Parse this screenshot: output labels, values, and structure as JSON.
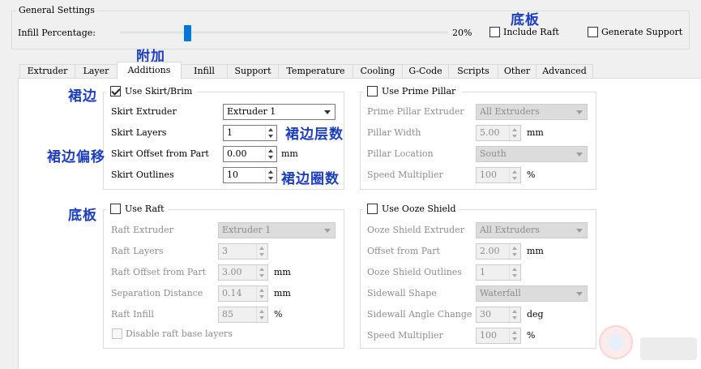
{
  "general": {
    "title": "General Settings",
    "infill_label": "Infill Percentage:",
    "infill_value": "20%",
    "infill_fraction": 0.2,
    "include_raft": "Include Raft",
    "generate_support": "Generate Support"
  },
  "tabs": [
    "Extruder",
    "Layer",
    "Additions",
    "Infill",
    "Support",
    "Temperature",
    "Cooling",
    "G-Code",
    "Scripts",
    "Other",
    "Advanced"
  ],
  "active_tab": "Additions",
  "skirt": {
    "title": "Use Skirt/Brim",
    "checked": true,
    "extruder_label": "Skirt Extruder",
    "extruder_value": "Extruder 1",
    "layers_label": "Skirt Layers",
    "layers_value": "1",
    "offset_label": "Skirt Offset from Part",
    "offset_value": "0.00",
    "offset_unit": "mm",
    "outlines_label": "Skirt Outlines",
    "outlines_value": "10"
  },
  "prime": {
    "title": "Use Prime Pillar",
    "extruder_label": "Prime Pillar Extruder",
    "extruder_value": "All Extruders",
    "width_label": "Pillar Width",
    "width_value": "5.00",
    "width_unit": "mm",
    "location_label": "Pillar Location",
    "location_value": "South",
    "speed_label": "Speed Multiplier",
    "speed_value": "100",
    "speed_unit": "%"
  },
  "raft": {
    "title": "Use Raft",
    "extruder_label": "Raft Extruder",
    "extruder_value": "Extruder 1",
    "layers_label": "Raft Layers",
    "layers_value": "3",
    "offset_label": "Raft Offset from Part",
    "offset_value": "3.00",
    "offset_unit": "mm",
    "sep_label": "Separation Distance",
    "sep_value": "0.14",
    "sep_unit": "mm",
    "infill_label": "Raft Infill",
    "infill_value": "85",
    "infill_unit": "%",
    "disable_base": "Disable raft base layers"
  },
  "ooze": {
    "title": "Use Ooze Shield",
    "extruder_label": "Ooze Shield Extruder",
    "extruder_value": "All Extruders",
    "offset_label": "Offset from Part",
    "offset_value": "2.00",
    "offset_unit": "mm",
    "outlines_label": "Ooze Shield Outlines",
    "outlines_value": "1",
    "shape_label": "Sidewall Shape",
    "shape_value": "Waterfall",
    "angle_label": "Sidewall Angle Change",
    "angle_value": "30",
    "angle_unit": "deg",
    "speed_label": "Speed Multiplier",
    "speed_value": "100",
    "speed_unit": "%"
  },
  "annotations": {
    "raft_top": "底板",
    "additions": "附加",
    "skirt": "裙边",
    "skirt_offset": "裙边偏移",
    "skirt_layers": "裙边层数",
    "skirt_outlines": "裙边圈数",
    "raft_left": "底板"
  },
  "colors": {
    "accent": "#0078d7",
    "annotation": "#1d3fbf"
  }
}
